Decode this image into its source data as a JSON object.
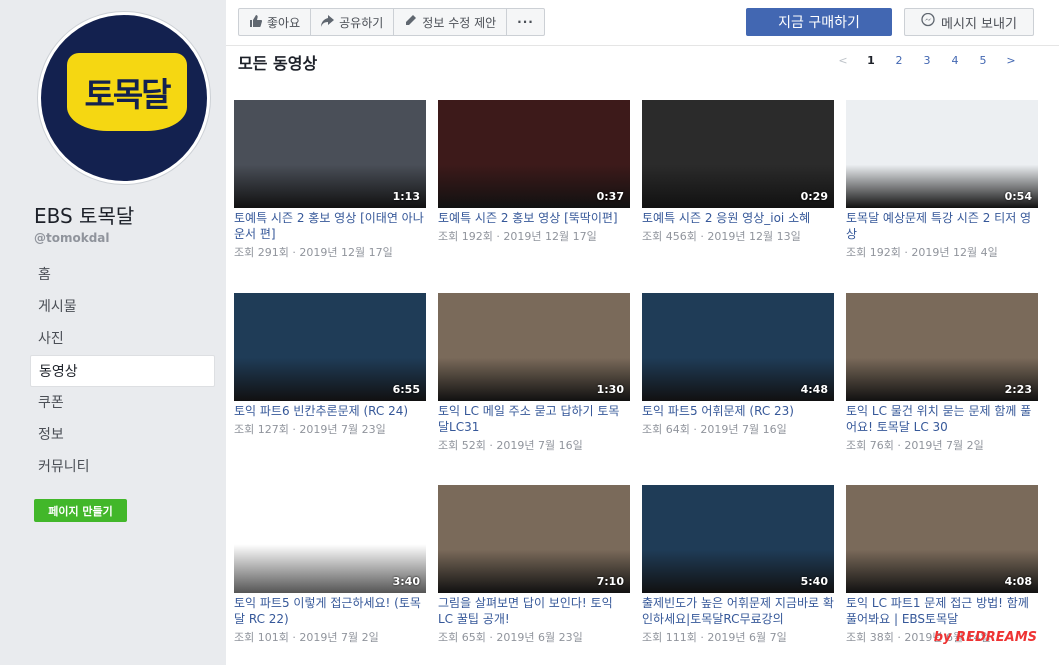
{
  "page": {
    "logo_text": "토목달",
    "name": "EBS 토목달",
    "handle": "@tomokdal",
    "create_page_button": "페이지 만들기"
  },
  "nav": [
    "홈",
    "게시물",
    "사진",
    "동영상",
    "쿠폰",
    "정보",
    "커뮤니티"
  ],
  "active_nav": "동영상",
  "toolbar": {
    "like": "좋아요",
    "share": "공유하기",
    "suggest_edit": "정보 수정 제안",
    "more": "···",
    "buy": "지금 구매하기",
    "message": "메시지 보내기"
  },
  "section_title": "모든 동영상",
  "pagination": {
    "prev": "<",
    "pages": [
      "1",
      "2",
      "3",
      "4",
      "5"
    ],
    "current": "1",
    "next": ">"
  },
  "videos": [
    {
      "title": "토예특 시즌 2 홍보 영상 [이태연 아나운서 편]",
      "meta": "조회 291회 · 2019년 12월 17일",
      "duration": "1:13",
      "bg": "#4a4f58"
    },
    {
      "title": "토예특 시즌 2 홍보 영상 [뚝딱이편]",
      "meta": "조회 192회 · 2019년 12월 17일",
      "duration": "0:37",
      "bg": "#3d1a1a"
    },
    {
      "title": "토예특 시즌 2 응원 영상_ioi 소혜",
      "meta": "조회 456회 · 2019년 12월 13일",
      "duration": "0:29",
      "bg": "#2b2b2b"
    },
    {
      "title": "토목달 예상문제 특강 시즌 2 티저 영상",
      "meta": "조회 192회 · 2019년 12월 4일",
      "duration": "0:54",
      "bg": "#eceff2"
    },
    {
      "title": "토익 파트6 빈칸추론문제 (RC 24)",
      "meta": "조회 127회 · 2019년 7월 23일",
      "duration": "6:55",
      "bg": "#1f3c57"
    },
    {
      "title": "토익 LC 메일 주소 묻고 답하기 토목달LC31",
      "meta": "조회 52회 · 2019년 7월 16일",
      "duration": "1:30",
      "bg": "#7a6a5a"
    },
    {
      "title": "토익 파트5 어휘문제 (RC 23)",
      "meta": "조회 64회 · 2019년 7월 16일",
      "duration": "4:48",
      "bg": "#1f3c57"
    },
    {
      "title": "토익 LC 물건 위치 묻는 문제 함께 풀어요! 토목달 LC 30",
      "meta": "조회 76회 · 2019년 7월 2일",
      "duration": "2:23",
      "bg": "#7a6a5a"
    },
    {
      "title": "토익 파트5 이렇게 접근하세요! (토목달 RC 22)",
      "meta": "조회 101회 · 2019년 7월 2일",
      "duration": "3:40",
      "bg": "#ffffff"
    },
    {
      "title": "그림을 살펴보면 답이 보인다! 토익 LC 꿀팁 공개!",
      "meta": "조회 65회 · 2019년 6월 23일",
      "duration": "7:10",
      "bg": "#7a6a5a"
    },
    {
      "title": "출제빈도가 높은 어휘문제 지금바로 확인하세요|토목달RC무료강의",
      "meta": "조회 111회 · 2019년 6월 7일",
      "duration": "5:40",
      "bg": "#1f3c57"
    },
    {
      "title": "토익 LC 파트1 문제 접근 방법! 함께 풀어봐요 | EBS토목달",
      "meta": "조회 38회 · 2019년 6월 14일",
      "duration": "4:08",
      "bg": "#7a6a5a"
    }
  ],
  "watermark": "by REDREAMS"
}
